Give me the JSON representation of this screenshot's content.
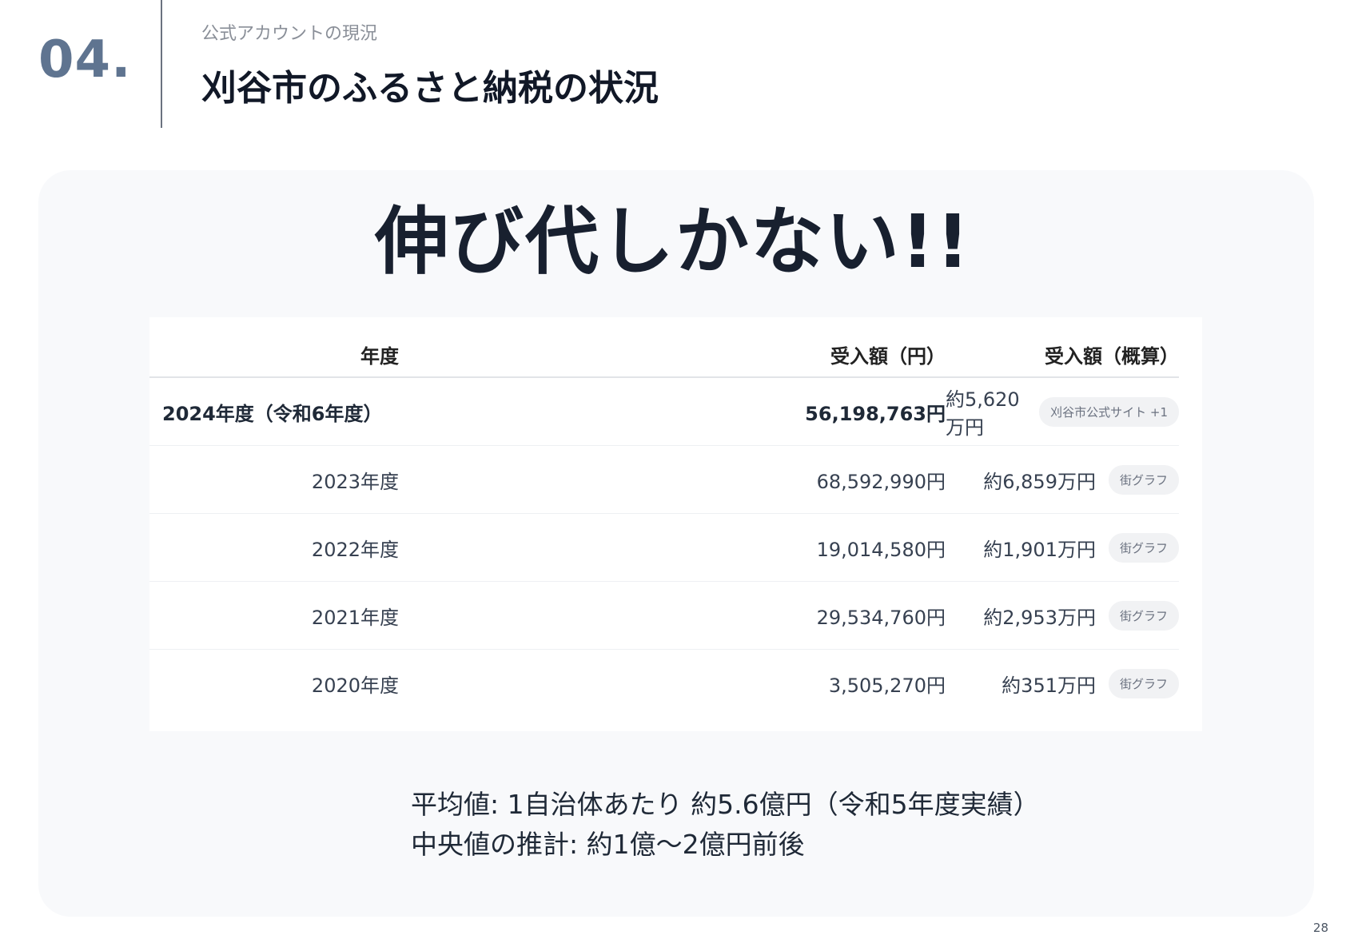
{
  "header": {
    "section_number": "04.",
    "eyebrow": "公式アカウントの現況",
    "title": "刈谷市のふるさと納税の状況"
  },
  "headline": "伸び代しかない!!",
  "table": {
    "columns": [
      "年度",
      "受入額（円）",
      "受入額（概算）"
    ],
    "rows": [
      {
        "year": "2024年度（令和6年度）",
        "amount": "56,198,763円",
        "approx": "約5,620万円",
        "source": "刈谷市公式サイト +1"
      },
      {
        "year": "2023年度",
        "amount": "68,592,990円",
        "approx": "約6,859万円",
        "source": "街グラフ"
      },
      {
        "year": "2022年度",
        "amount": "19,014,580円",
        "approx": "約1,901万円",
        "source": "街グラフ"
      },
      {
        "year": "2021年度",
        "amount": "29,534,760円",
        "approx": "約2,953万円",
        "source": "街グラフ"
      },
      {
        "year": "2020年度",
        "amount": "3,505,270円",
        "approx": "約351万円",
        "source": "街グラフ"
      }
    ]
  },
  "summary": {
    "line1": "平均値: 1自治体あたり 約5.6億円（令和5年度実績）",
    "line2": "中央値の推計: 約1億〜2億円前後"
  },
  "page_number": "28"
}
